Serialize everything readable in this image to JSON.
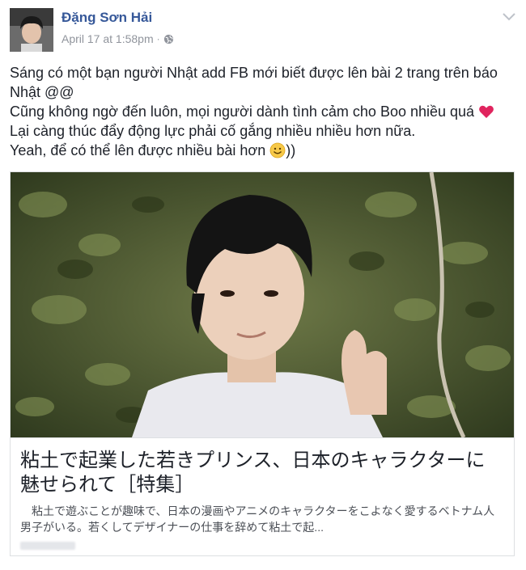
{
  "post": {
    "author": "Đặng Sơn Hải",
    "timestamp": "April 17 at 1:58pm",
    "separator": "·",
    "privacy_icon": "globe-icon",
    "menu_icon": "chevron-down-icon",
    "lines": [
      "Sáng có một bạn người Nhật add FB mới biết được lên bài 2 trang trên báo Nhật @@",
      "Cũng không ngờ đến luôn, mọi người dành tình cảm cho Boo nhiều quá",
      "Lại càng thúc đẩy động lực phải cố gắng nhiều nhiều hơn nữa.",
      "Yeah, để có thể lên được nhiều bài hơn",
      "))"
    ],
    "emoji": {
      "heart": "heart-emoji",
      "smile": "smile-emoji"
    }
  },
  "link_card": {
    "title": "粘土で起業した若きプリンス、日本のキャラクターに魅せられて［特集］",
    "description": "　粘土で遊ぶことが趣味で、日本の漫画やアニメのキャラクターをこよなく愛するベトナム人男子がいる。若くしてデザイナーの仕事を辞めて粘土で起..."
  },
  "colors": {
    "author": "#365899",
    "meta": "#90949c",
    "heart": "#e0245e",
    "border": "#dddfe2"
  }
}
